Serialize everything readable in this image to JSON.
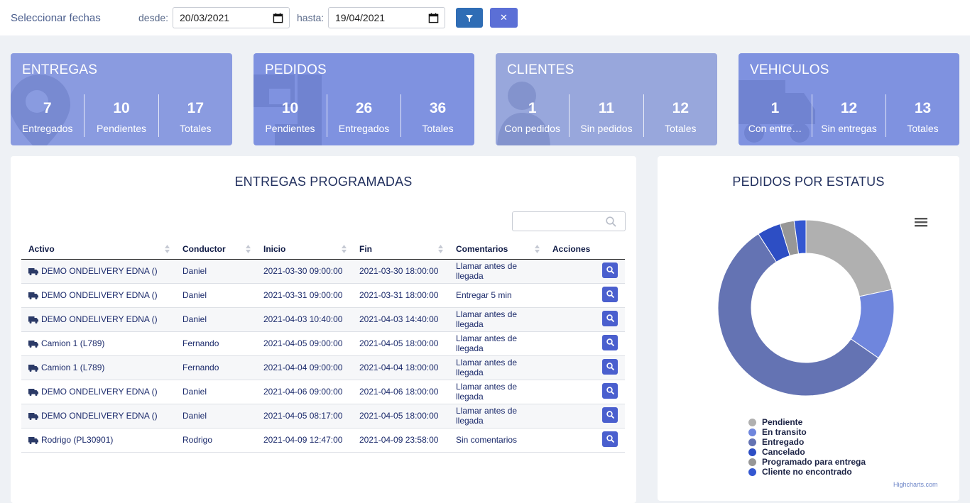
{
  "filter": {
    "label": "Seleccionar fechas",
    "from_label": "desde:",
    "from_value": "20/03/2021",
    "to_label": "hasta:",
    "to_value": "19/04/2021",
    "filter_icon": "filter-icon",
    "clear_icon": "close-icon",
    "clear_glyph": "✕"
  },
  "cards": [
    {
      "title": "ENTREGAS",
      "color": "#8a9be0",
      "icon": "map-pin-icon",
      "stats": [
        {
          "num": "7",
          "cap": "Entregados"
        },
        {
          "num": "10",
          "cap": "Pendientes"
        },
        {
          "num": "17",
          "cap": "Totales"
        }
      ]
    },
    {
      "title": "PEDIDOS",
      "color": "#7f92e0",
      "icon": "boxes-icon",
      "stats": [
        {
          "num": "10",
          "cap": "Pendientes"
        },
        {
          "num": "26",
          "cap": "Entregados"
        },
        {
          "num": "36",
          "cap": "Totales"
        }
      ]
    },
    {
      "title": "CLIENTES",
      "color": "#98a7dc",
      "icon": "user-icon",
      "stats": [
        {
          "num": "1",
          "cap": "Con pedidos"
        },
        {
          "num": "11",
          "cap": "Sin pedidos"
        },
        {
          "num": "12",
          "cap": "Totales"
        }
      ]
    },
    {
      "title": "VEHICULOS",
      "color": "#7f92e0",
      "icon": "truck-icon",
      "stats": [
        {
          "num": "1",
          "cap": "Con entre…"
        },
        {
          "num": "12",
          "cap": "Sin entregas"
        },
        {
          "num": "13",
          "cap": "Totales"
        }
      ]
    }
  ],
  "schedule": {
    "title": "ENTREGAS PROGRAMADAS",
    "search_placeholder": "",
    "columns": [
      "Activo",
      "Conductor",
      "Inicio",
      "Fin",
      "Comentarios",
      "Acciones"
    ],
    "rows": [
      {
        "activo": "DEMO ONDELIVERY EDNA ()",
        "conductor": "Daniel",
        "inicio": "2021-03-30 09:00:00",
        "fin": "2021-03-30 18:00:00",
        "comentarios": "Llamar antes de llegada"
      },
      {
        "activo": "DEMO ONDELIVERY EDNA ()",
        "conductor": "Daniel",
        "inicio": "2021-03-31 09:00:00",
        "fin": "2021-03-31 18:00:00",
        "comentarios": "Entregar 5 min"
      },
      {
        "activo": "DEMO ONDELIVERY EDNA ()",
        "conductor": "Daniel",
        "inicio": "2021-04-03 10:40:00",
        "fin": "2021-04-03 14:40:00",
        "comentarios": "Llamar antes de llegada"
      },
      {
        "activo": "Camion 1 (L789)",
        "conductor": "Fernando",
        "inicio": "2021-04-05 09:00:00",
        "fin": "2021-04-05 18:00:00",
        "comentarios": "Llamar antes de llegada"
      },
      {
        "activo": "Camion 1 (L789)",
        "conductor": "Fernando",
        "inicio": "2021-04-04 09:00:00",
        "fin": "2021-04-04 18:00:00",
        "comentarios": "Llamar antes de llegada"
      },
      {
        "activo": "DEMO ONDELIVERY EDNA ()",
        "conductor": "Daniel",
        "inicio": "2021-04-06 09:00:00",
        "fin": "2021-04-06 18:00:00",
        "comentarios": "Llamar antes de llegada"
      },
      {
        "activo": "DEMO ONDELIVERY EDNA ()",
        "conductor": "Daniel",
        "inicio": "2021-04-05 08:17:00",
        "fin": "2021-04-05 18:00:00",
        "comentarios": "Llamar antes de llegada"
      },
      {
        "activo": "Rodrigo (PL30901)",
        "conductor": "Rodrigo",
        "inicio": "2021-04-09 12:47:00",
        "fin": "2021-04-09 23:58:00",
        "comentarios": "Sin comentarios"
      }
    ]
  },
  "chart_data": {
    "type": "pie",
    "variant": "donut",
    "title": "PEDIDOS POR ESTATUS",
    "legend_position": "bottom",
    "credits": "Highcharts.com",
    "slices": [
      {
        "name": "Pendiente",
        "value": 10,
        "color": "#b0b0b0"
      },
      {
        "name": "En transito",
        "value": 6,
        "color": "#6f86dd"
      },
      {
        "name": "Entregado",
        "value": 26,
        "color": "#6473b3"
      },
      {
        "name": "Cancelado",
        "value": 2,
        "color": "#2d4ec4"
      },
      {
        "name": "Programado para entrega",
        "value": 1.2,
        "color": "#979797"
      },
      {
        "name": "Cliente no encontrado",
        "value": 1.0,
        "color": "#3457d1"
      }
    ]
  }
}
